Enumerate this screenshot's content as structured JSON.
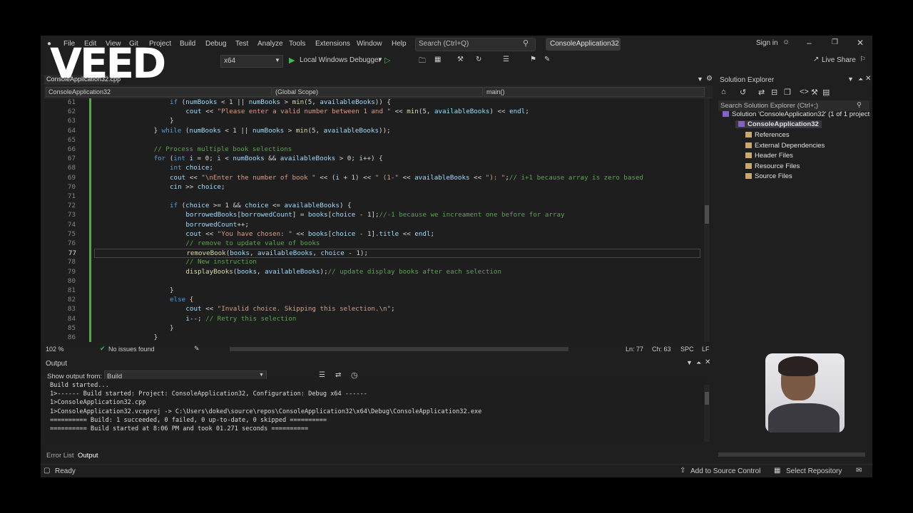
{
  "watermark": "VEED",
  "menu": [
    "File",
    "Edit",
    "View",
    "Git",
    "Project",
    "Build",
    "Debug",
    "Test",
    "Analyze",
    "Tools",
    "Extensions",
    "Window",
    "Help"
  ],
  "search": {
    "placeholder": "Search (Ctrl+Q)"
  },
  "project_title": "ConsoleApplication32",
  "sign_in": "Sign in",
  "toolbar": {
    "platform": "x64",
    "debugger": "Local Windows Debugger",
    "live_share": "Live Share"
  },
  "doc_tab": "ConsoleApplication32.cpp",
  "navbar": {
    "project": "ConsoleApplication32",
    "scope": "(Global Scope)",
    "member": "main()"
  },
  "code_lines": [
    {
      "n": "61",
      "indent": 10,
      "parts": [
        [
          "kw",
          "if"
        ],
        [
          "pl",
          " ("
        ],
        [
          "var",
          "numBooks"
        ],
        [
          "pl",
          " < 1 || "
        ],
        [
          "var",
          "numBooks"
        ],
        [
          "pl",
          " > "
        ],
        [
          "fn",
          "min"
        ],
        [
          "pl",
          "(5, "
        ],
        [
          "var",
          "availableBooks"
        ],
        [
          "pl",
          ")) {"
        ]
      ]
    },
    {
      "n": "62",
      "indent": 14,
      "parts": [
        [
          "var",
          "cout"
        ],
        [
          "pl",
          " << "
        ],
        [
          "str",
          "\"Please enter a valid number between 1 and \""
        ],
        [
          "pl",
          " << "
        ],
        [
          "fn",
          "min"
        ],
        [
          "pl",
          "(5, "
        ],
        [
          "var",
          "availableBooks"
        ],
        [
          "pl",
          ") << "
        ],
        [
          "var",
          "endl"
        ],
        [
          "pl",
          ";"
        ]
      ]
    },
    {
      "n": "63",
      "indent": 10,
      "parts": [
        [
          "pl",
          "}"
        ]
      ]
    },
    {
      "n": "64",
      "indent": 6,
      "parts": [
        [
          "pl",
          "} "
        ],
        [
          "kw",
          "while"
        ],
        [
          "pl",
          " ("
        ],
        [
          "var",
          "numBooks"
        ],
        [
          "pl",
          " < 1 || "
        ],
        [
          "var",
          "numBooks"
        ],
        [
          "pl",
          " > "
        ],
        [
          "fn",
          "min"
        ],
        [
          "pl",
          "(5, "
        ],
        [
          "var",
          "availableBooks"
        ],
        [
          "pl",
          "));"
        ]
      ]
    },
    {
      "n": "65",
      "indent": 0,
      "parts": []
    },
    {
      "n": "66",
      "indent": 6,
      "parts": [
        [
          "cm",
          "// Process multiple book selections"
        ]
      ]
    },
    {
      "n": "67",
      "indent": 6,
      "parts": [
        [
          "kw",
          "for"
        ],
        [
          "pl",
          " ("
        ],
        [
          "kw",
          "int"
        ],
        [
          "pl",
          " "
        ],
        [
          "var",
          "i"
        ],
        [
          "pl",
          " = 0; "
        ],
        [
          "var",
          "i"
        ],
        [
          "pl",
          " < "
        ],
        [
          "var",
          "numBooks"
        ],
        [
          "pl",
          " && "
        ],
        [
          "var",
          "availableBooks"
        ],
        [
          "pl",
          " > 0; "
        ],
        [
          "var",
          "i"
        ],
        [
          "pl",
          "++) {"
        ]
      ]
    },
    {
      "n": "68",
      "indent": 10,
      "parts": [
        [
          "kw",
          "int"
        ],
        [
          "pl",
          " "
        ],
        [
          "var",
          "choice"
        ],
        [
          "pl",
          ";"
        ]
      ]
    },
    {
      "n": "69",
      "indent": 10,
      "parts": [
        [
          "var",
          "cout"
        ],
        [
          "pl",
          " << "
        ],
        [
          "str",
          "\"\\nEnter the number of book \""
        ],
        [
          "pl",
          " << ("
        ],
        [
          "var",
          "i"
        ],
        [
          "pl",
          " + 1) << "
        ],
        [
          "str",
          "\" (1-\""
        ],
        [
          "pl",
          " << "
        ],
        [
          "var",
          "availableBooks"
        ],
        [
          "pl",
          " << "
        ],
        [
          "str",
          "\"): \""
        ],
        [
          "pl",
          ";"
        ],
        [
          "cm",
          "// i+1 because array is zero based"
        ]
      ]
    },
    {
      "n": "70",
      "indent": 10,
      "parts": [
        [
          "var",
          "cin"
        ],
        [
          "pl",
          " >> "
        ],
        [
          "var",
          "choice"
        ],
        [
          "pl",
          ";"
        ]
      ]
    },
    {
      "n": "71",
      "indent": 0,
      "parts": []
    },
    {
      "n": "72",
      "indent": 10,
      "parts": [
        [
          "kw",
          "if"
        ],
        [
          "pl",
          " ("
        ],
        [
          "var",
          "choice"
        ],
        [
          "pl",
          " >= 1 && "
        ],
        [
          "var",
          "choice"
        ],
        [
          "pl",
          " <= "
        ],
        [
          "var",
          "availableBooks"
        ],
        [
          "pl",
          ") {"
        ]
      ]
    },
    {
      "n": "73",
      "indent": 14,
      "parts": [
        [
          "var",
          "borrowedBooks"
        ],
        [
          "pl",
          "["
        ],
        [
          "var",
          "borrowedCount"
        ],
        [
          "pl",
          "] = "
        ],
        [
          "var",
          "books"
        ],
        [
          "pl",
          "["
        ],
        [
          "var",
          "choice"
        ],
        [
          "pl",
          " - 1];"
        ],
        [
          "cm",
          "//-1 because we increament one before for array"
        ]
      ]
    },
    {
      "n": "74",
      "indent": 14,
      "parts": [
        [
          "var",
          "borrowedCount"
        ],
        [
          "pl",
          "++;"
        ]
      ]
    },
    {
      "n": "75",
      "indent": 14,
      "parts": [
        [
          "var",
          "cout"
        ],
        [
          "pl",
          " << "
        ],
        [
          "str",
          "\"You have chosen: \""
        ],
        [
          "pl",
          " << "
        ],
        [
          "var",
          "books"
        ],
        [
          "pl",
          "["
        ],
        [
          "var",
          "choice"
        ],
        [
          "pl",
          " - 1]."
        ],
        [
          "var",
          "title"
        ],
        [
          "pl",
          " << "
        ],
        [
          "var",
          "endl"
        ],
        [
          "pl",
          ";"
        ]
      ]
    },
    {
      "n": "76",
      "indent": 14,
      "parts": [
        [
          "cm",
          "// remove to update value of books"
        ]
      ]
    },
    {
      "n": "77",
      "indent": 14,
      "parts": [
        [
          "fn",
          "removeBook"
        ],
        [
          "pl",
          "("
        ],
        [
          "var",
          "books"
        ],
        [
          "pl",
          ", "
        ],
        [
          "var",
          "availableBooks"
        ],
        [
          "pl",
          ", "
        ],
        [
          "var",
          "choice"
        ],
        [
          "pl",
          " - 1);"
        ]
      ]
    },
    {
      "n": "78",
      "indent": 14,
      "parts": [
        [
          "cm",
          "// New instruction"
        ]
      ]
    },
    {
      "n": "79",
      "indent": 14,
      "parts": [
        [
          "fn",
          "displayBooks"
        ],
        [
          "pl",
          "("
        ],
        [
          "var",
          "books"
        ],
        [
          "pl",
          ", "
        ],
        [
          "var",
          "availableBooks"
        ],
        [
          "pl",
          ");"
        ],
        [
          "cm",
          "// update display books after each selection"
        ]
      ]
    },
    {
      "n": "80",
      "indent": 0,
      "parts": []
    },
    {
      "n": "81",
      "indent": 10,
      "parts": [
        [
          "pl",
          "}"
        ]
      ]
    },
    {
      "n": "82",
      "indent": 10,
      "parts": [
        [
          "kw",
          "else"
        ],
        [
          "pl",
          " {"
        ]
      ]
    },
    {
      "n": "83",
      "indent": 14,
      "parts": [
        [
          "var",
          "cout"
        ],
        [
          "pl",
          " << "
        ],
        [
          "str",
          "\"Invalid choice. Skipping this selection.\\n\""
        ],
        [
          "pl",
          ";"
        ]
      ]
    },
    {
      "n": "84",
      "indent": 14,
      "parts": [
        [
          "var",
          "i"
        ],
        [
          "pl",
          "--; "
        ],
        [
          "cm",
          "// Retry this selection"
        ]
      ]
    },
    {
      "n": "85",
      "indent": 10,
      "parts": [
        [
          "pl",
          "}"
        ]
      ]
    },
    {
      "n": "86",
      "indent": 6,
      "parts": [
        [
          "pl",
          "}"
        ]
      ]
    }
  ],
  "current_line": "77",
  "editor_status": {
    "zoom": "102 %",
    "issues": "No issues found",
    "ln": "Ln: 77",
    "ch": "Ch: 63",
    "spc": "SPC",
    "lf": "LF"
  },
  "solution_explorer": {
    "title": "Solution Explorer",
    "search_placeholder": "Search Solution Explorer (Ctrl+;)",
    "items": [
      {
        "label": "Solution 'ConsoleApplication32' (1 of 1 project",
        "level": 0
      },
      {
        "label": "ConsoleApplication32",
        "level": 1
      },
      {
        "label": "References",
        "level": 2
      },
      {
        "label": "External Dependencies",
        "level": 2
      },
      {
        "label": "Header Files",
        "level": 2
      },
      {
        "label": "Resource Files",
        "level": 2
      },
      {
        "label": "Source Files",
        "level": 2
      }
    ]
  },
  "output": {
    "title": "Output",
    "show_from_label": "Show output from:",
    "source": "Build",
    "lines": [
      "Build started...",
      "1>------ Build started: Project: ConsoleApplication32, Configuration: Debug x64 ------",
      "1>ConsoleApplication32.cpp",
      "1>ConsoleApplication32.vcxproj -> C:\\Users\\doked\\source\\repos\\ConsoleApplication32\\x64\\Debug\\ConsoleApplication32.exe",
      "========== Build: 1 succeeded, 0 failed, 0 up-to-date, 0 skipped ==========",
      "========== Build started at 8:06 PM and took 01.271 seconds =========="
    ]
  },
  "bottom_tabs": [
    "Error List",
    "Output"
  ],
  "statusbar": {
    "ready": "Ready",
    "source_control": "Add to Source Control",
    "repository": "Select Repository"
  }
}
